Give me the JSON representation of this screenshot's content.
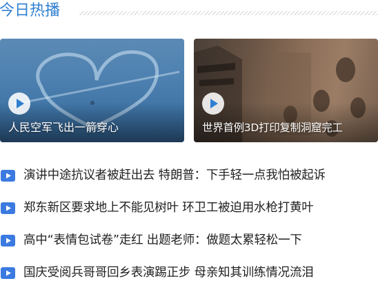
{
  "header": {
    "title": "今日热播"
  },
  "featured": [
    {
      "caption": "人民空军飞出一箭穿心",
      "icon": "play-icon"
    },
    {
      "caption": "世界首例3D打印复制洞窟完工",
      "icon": "play-icon"
    }
  ],
  "news": [
    {
      "title": "演讲中途抗议者被赶出去 特朗普：下手轻一点我怕被起诉",
      "icon": "video-icon"
    },
    {
      "title": "郑东新区要求地上不能见树叶 环卫工被迫用水枪打黄叶",
      "icon": "video-icon"
    },
    {
      "title": "高中“表情包试卷”走红 出题老师：做题太累轻松一下",
      "icon": "video-icon"
    },
    {
      "title": "国庆受阅兵哥哥回乡表演踢正步 母亲知其训练情况流泪",
      "icon": "video-icon"
    }
  ],
  "colors": {
    "accent": "#2f7fd1",
    "icon": "#3b7ae0",
    "text": "#222222"
  }
}
